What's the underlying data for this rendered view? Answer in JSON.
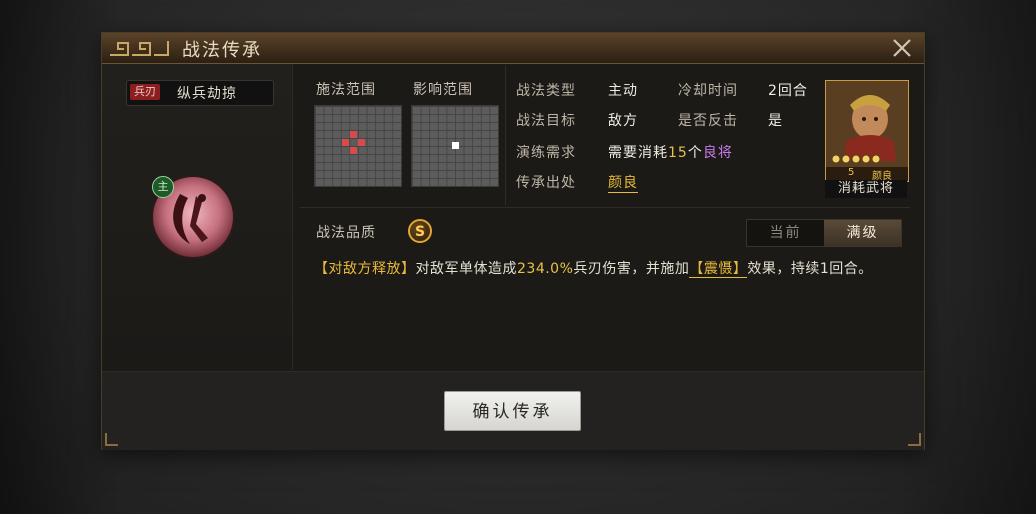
{
  "dialog": {
    "title": "战法传承"
  },
  "skill": {
    "type_tag": "兵刃",
    "name": "纵兵劫掠",
    "main_badge": "主"
  },
  "range": {
    "cast_label": "施法范围",
    "effect_label": "影响范围"
  },
  "info": {
    "type_label": "战法类型",
    "type_value": "主动",
    "cooldown_label": "冷却时间",
    "cooldown_value": "2回合",
    "target_label": "战法目标",
    "target_value": "敌方",
    "counter_label": "是否反击",
    "counter_value": "是",
    "train_label": "演练需求",
    "train_prefix": "需要消耗",
    "train_count": "15",
    "train_unit": "个",
    "train_item": "良将",
    "source_label": "传承出处",
    "source_value": "颜良"
  },
  "card": {
    "caption": "消耗武将",
    "rank": "5",
    "name": "颜良"
  },
  "quality": {
    "label": "战法品质",
    "grade": "S"
  },
  "level_toggle": {
    "current": "当前",
    "max": "满级"
  },
  "description": {
    "tag": "【对敌方释放】",
    "text1": "对敌军单体造成",
    "damage": "234.0%",
    "text2": "兵刃伤害，并施加",
    "buff": "【震慑】",
    "text3": "效果，持续1回合。"
  },
  "footer": {
    "confirm": "确认传承"
  },
  "colors": {
    "accent_gold": "#e8b93a",
    "tag_red": "#8b1f1f",
    "highlight_purple": "#c77ae6"
  }
}
